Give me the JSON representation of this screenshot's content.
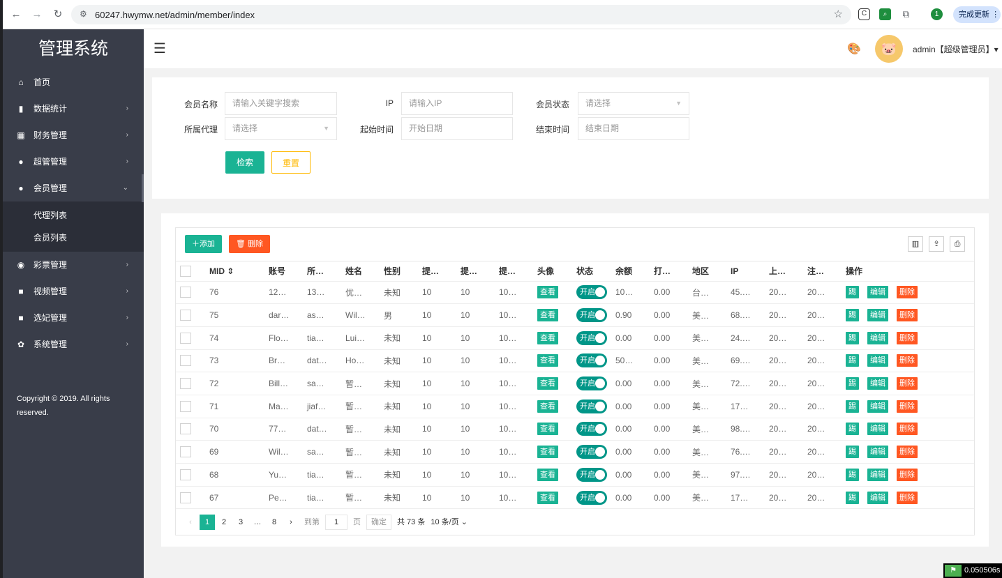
{
  "browser": {
    "url": "60247.hwymw.net/admin/member/index",
    "update_label": "完成更新",
    "ext_badge": "1"
  },
  "sidebar": {
    "logo": "管理系统",
    "items": [
      {
        "label": "首页",
        "icon": "home-icon",
        "glyph": "⌂",
        "arrow": ""
      },
      {
        "label": "数据统计",
        "icon": "chart-icon",
        "glyph": "▮",
        "arrow": "›"
      },
      {
        "label": "财务管理",
        "icon": "bank-icon",
        "glyph": "▦",
        "arrow": "›"
      },
      {
        "label": "超管管理",
        "icon": "user-icon",
        "glyph": "●",
        "arrow": "›"
      },
      {
        "label": "会员管理",
        "icon": "users-icon",
        "glyph": "●",
        "arrow": "⌄"
      },
      {
        "label": "彩票管理",
        "icon": "gamepad-icon",
        "glyph": "◉",
        "arrow": "›"
      },
      {
        "label": "视频管理",
        "icon": "video-icon",
        "glyph": "■",
        "arrow": "›"
      },
      {
        "label": "选妃管理",
        "icon": "video-icon",
        "glyph": "■",
        "arrow": "›"
      },
      {
        "label": "系统管理",
        "icon": "gear-icon",
        "glyph": "✿",
        "arrow": "›"
      }
    ],
    "sub_items": [
      "代理列表",
      "会员列表"
    ],
    "copyright": "Copyright © 2019. All rights reserved."
  },
  "header": {
    "admin_label": "admin【超级管理员】▾"
  },
  "search": {
    "name_label": "会员名称",
    "name_placeholder": "请输入关键字搜索",
    "ip_label": "IP",
    "ip_placeholder": "请输入IP",
    "status_label": "会员状态",
    "status_placeholder": "请选择",
    "agent_label": "所属代理",
    "agent_placeholder": "请选择",
    "start_label": "起始时间",
    "start_placeholder": "开始日期",
    "end_label": "结束时间",
    "end_placeholder": "结束日期",
    "search_button": "检索",
    "reset_button": "重置"
  },
  "toolbar": {
    "add_label": "＋添加",
    "delete_label": "🗑 删除"
  },
  "table": {
    "headers": [
      "MID ⇕",
      "账号",
      "所…",
      "姓名",
      "性别",
      "提…",
      "提…",
      "提…",
      "头像",
      "状态",
      "余额",
      "打…",
      "地区",
      "IP",
      "上…",
      "注…",
      "操作"
    ],
    "view_label": "查看",
    "switch_label": "开启",
    "kick_label": "踢",
    "edit_label": "编辑",
    "del_label": "删除",
    "rows": [
      {
        "mid": "76",
        "account": "12…",
        "agent": "13…",
        "name": "优…",
        "gender": "未知",
        "c1": "10",
        "c2": "10",
        "c3": "10…",
        "balance": "10…",
        "bet": "0.00",
        "region": "台…",
        "ip": "45.…",
        "last": "20…",
        "reg": "20…"
      },
      {
        "mid": "75",
        "account": "dar…",
        "agent": "as…",
        "name": "Wil…",
        "gender": "男",
        "c1": "10",
        "c2": "10",
        "c3": "10…",
        "balance": "0.90",
        "bet": "0.00",
        "region": "美…",
        "ip": "68.…",
        "last": "20…",
        "reg": "20…"
      },
      {
        "mid": "74",
        "account": "Flo…",
        "agent": "tia…",
        "name": "Lui…",
        "gender": "未知",
        "c1": "10",
        "c2": "10",
        "c3": "10…",
        "balance": "0.00",
        "bet": "0.00",
        "region": "美…",
        "ip": "24.…",
        "last": "20…",
        "reg": "20…"
      },
      {
        "mid": "73",
        "account": "Br…",
        "agent": "dat…",
        "name": "Ho…",
        "gender": "未知",
        "c1": "10",
        "c2": "10",
        "c3": "10…",
        "balance": "50…",
        "bet": "0.00",
        "region": "美…",
        "ip": "69.…",
        "last": "20…",
        "reg": "20…"
      },
      {
        "mid": "72",
        "account": "Bill…",
        "agent": "sa…",
        "name": "暂…",
        "gender": "未知",
        "c1": "10",
        "c2": "10",
        "c3": "10…",
        "balance": "0.00",
        "bet": "0.00",
        "region": "美…",
        "ip": "72.…",
        "last": "20…",
        "reg": "20…"
      },
      {
        "mid": "71",
        "account": "Ma…",
        "agent": "jiaf…",
        "name": "暂…",
        "gender": "未知",
        "c1": "10",
        "c2": "10",
        "c3": "10…",
        "balance": "0.00",
        "bet": "0.00",
        "region": "美…",
        "ip": "17…",
        "last": "20…",
        "reg": "20…"
      },
      {
        "mid": "70",
        "account": "77…",
        "agent": "dat…",
        "name": "暂…",
        "gender": "未知",
        "c1": "10",
        "c2": "10",
        "c3": "10…",
        "balance": "0.00",
        "bet": "0.00",
        "region": "美…",
        "ip": "98.…",
        "last": "20…",
        "reg": "20…"
      },
      {
        "mid": "69",
        "account": "Wil…",
        "agent": "sa…",
        "name": "暂…",
        "gender": "未知",
        "c1": "10",
        "c2": "10",
        "c3": "10…",
        "balance": "0.00",
        "bet": "0.00",
        "region": "美…",
        "ip": "76.…",
        "last": "20…",
        "reg": "20…"
      },
      {
        "mid": "68",
        "account": "Yu…",
        "agent": "tia…",
        "name": "暂…",
        "gender": "未知",
        "c1": "10",
        "c2": "10",
        "c3": "10…",
        "balance": "0.00",
        "bet": "0.00",
        "region": "美…",
        "ip": "97.…",
        "last": "20…",
        "reg": "20…"
      },
      {
        "mid": "67",
        "account": "Pe…",
        "agent": "tia…",
        "name": "暂…",
        "gender": "未知",
        "c1": "10",
        "c2": "10",
        "c3": "10…",
        "balance": "0.00",
        "bet": "0.00",
        "region": "美…",
        "ip": "17…",
        "last": "20…",
        "reg": "20…"
      }
    ]
  },
  "pager": {
    "pages": [
      "1",
      "2",
      "3",
      "…",
      "8"
    ],
    "goto_label": "到第",
    "goto_value": "1",
    "page_unit": "页",
    "ok_label": "确定",
    "total_label": "共 73 条",
    "size_label": "10 条/页 ⌄"
  },
  "timer": "0.050506s",
  "colors": {
    "accent": "#009688",
    "teal_button": "#1ab394",
    "danger": "#ff5722",
    "sidebar": "#393d49"
  }
}
